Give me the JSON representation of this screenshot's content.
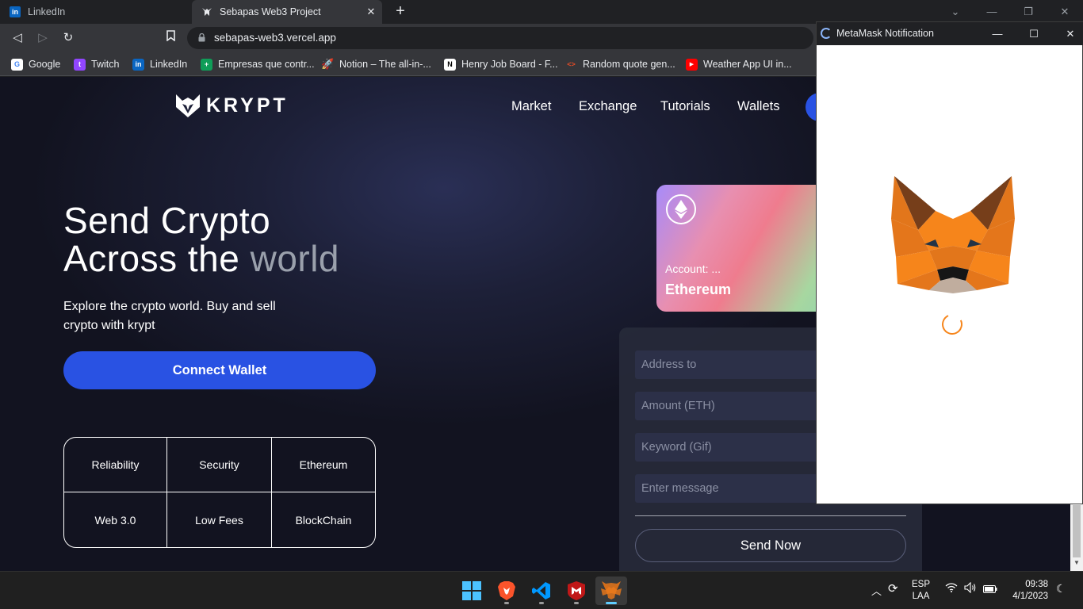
{
  "browser": {
    "tabs": [
      {
        "label": "LinkedIn",
        "active": false,
        "icon": "linkedin-icon"
      },
      {
        "label": "Sebapas Web3 Project",
        "active": true,
        "icon": "krypt-icon"
      }
    ],
    "url": "sebapas-web3.vercel.app",
    "bookmarks": [
      {
        "label": "Google",
        "icon": "google-icon"
      },
      {
        "label": "Twitch",
        "icon": "twitch-icon"
      },
      {
        "label": "LinkedIn",
        "icon": "linkedin-icon"
      },
      {
        "label": "Empresas que contr...",
        "icon": "sheets-icon"
      },
      {
        "label": "Notion – The all-in-...",
        "icon": "rocket-icon"
      },
      {
        "label": "Henry Job Board - F...",
        "icon": "notion-icon"
      },
      {
        "label": "Random quote gen...",
        "icon": "code-icon"
      },
      {
        "label": "Weather App UI in...",
        "icon": "youtube-icon"
      }
    ]
  },
  "site": {
    "brand": "KRYPT",
    "nav": [
      "Market",
      "Exchange",
      "Tutorials",
      "Wallets"
    ],
    "hero": {
      "title_line1": "Send Crypto",
      "title_line2a": "Across the ",
      "title_line2b": "world",
      "subtitle": "Explore the crypto world. Buy and sell crypto with krypt",
      "cta": "Connect Wallet"
    },
    "features": [
      "Reliability",
      "Security",
      "Ethereum",
      "Web 3.0",
      "Low Fees",
      "BlockChain"
    ],
    "card": {
      "account": "Account: ...",
      "chain": "Ethereum"
    },
    "form": {
      "address_placeholder": "Address to",
      "amount_placeholder": "Amount (ETH)",
      "keyword_placeholder": "Keyword (Gif)",
      "message_placeholder": "Enter message",
      "submit": "Send Now"
    }
  },
  "metamask": {
    "title": "MetaMask Notification",
    "status": "loading"
  },
  "taskbar": {
    "apps": [
      "windows-start-icon",
      "brave-icon",
      "vscode-icon",
      "mcafee-icon",
      "metamask-icon"
    ],
    "language_line1": "ESP",
    "language_line2": "LAA",
    "time": "09:38",
    "date": "4/1/2023"
  },
  "colors": {
    "accent": "#2952e3",
    "page_bg": "#121320",
    "metamask_orange": "#f6851b"
  }
}
